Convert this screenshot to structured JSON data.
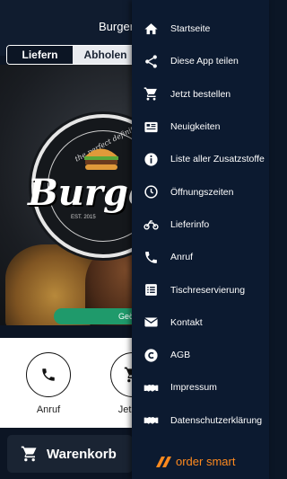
{
  "app": {
    "title": "Burger",
    "tabs": [
      {
        "label": "Liefern",
        "active": true
      },
      {
        "label": "Abholen",
        "active": false
      }
    ],
    "logo": {
      "arc_text": "the perfect definition",
      "name": "Burge",
      "est": "EST. 2015"
    },
    "hero_pill_text": "Geö",
    "actions": [
      {
        "label": "Anruf",
        "icon": "phone-icon"
      },
      {
        "label": "Jetzt b",
        "icon": "cart-icon"
      }
    ],
    "cart_label": "Warenkorb"
  },
  "drawer": {
    "items": [
      {
        "label": "Startseite",
        "icon": "home-icon"
      },
      {
        "label": "Diese App teilen",
        "icon": "share-icon"
      },
      {
        "label": "Jetzt bestellen",
        "icon": "cart-icon"
      },
      {
        "label": "Neuigkeiten",
        "icon": "news-icon"
      },
      {
        "label": "Liste aller Zusatzstoffe",
        "icon": "info-icon"
      },
      {
        "label": "Öffnungszeiten",
        "icon": "clock-icon"
      },
      {
        "label": "Lieferinfo",
        "icon": "motorbike-icon"
      },
      {
        "label": "Anruf",
        "icon": "phone-icon"
      },
      {
        "label": "Tischreservierung",
        "icon": "list-icon"
      },
      {
        "label": "Kontakt",
        "icon": "envelope-icon"
      },
      {
        "label": "AGB",
        "icon": "copyright-icon"
      },
      {
        "label": "Impressum",
        "icon": "handshake-icon"
      },
      {
        "label": "Datenschutzerklärung",
        "icon": "handshake-icon"
      }
    ],
    "brand": {
      "label": "order smart",
      "color": "#ff8a1e"
    }
  },
  "colors": {
    "drawer_bg": "#0c1a30",
    "topbar_bg": "#101c2f",
    "accent_green": "#1f9a6b",
    "brand_orange": "#ff8a1e"
  }
}
